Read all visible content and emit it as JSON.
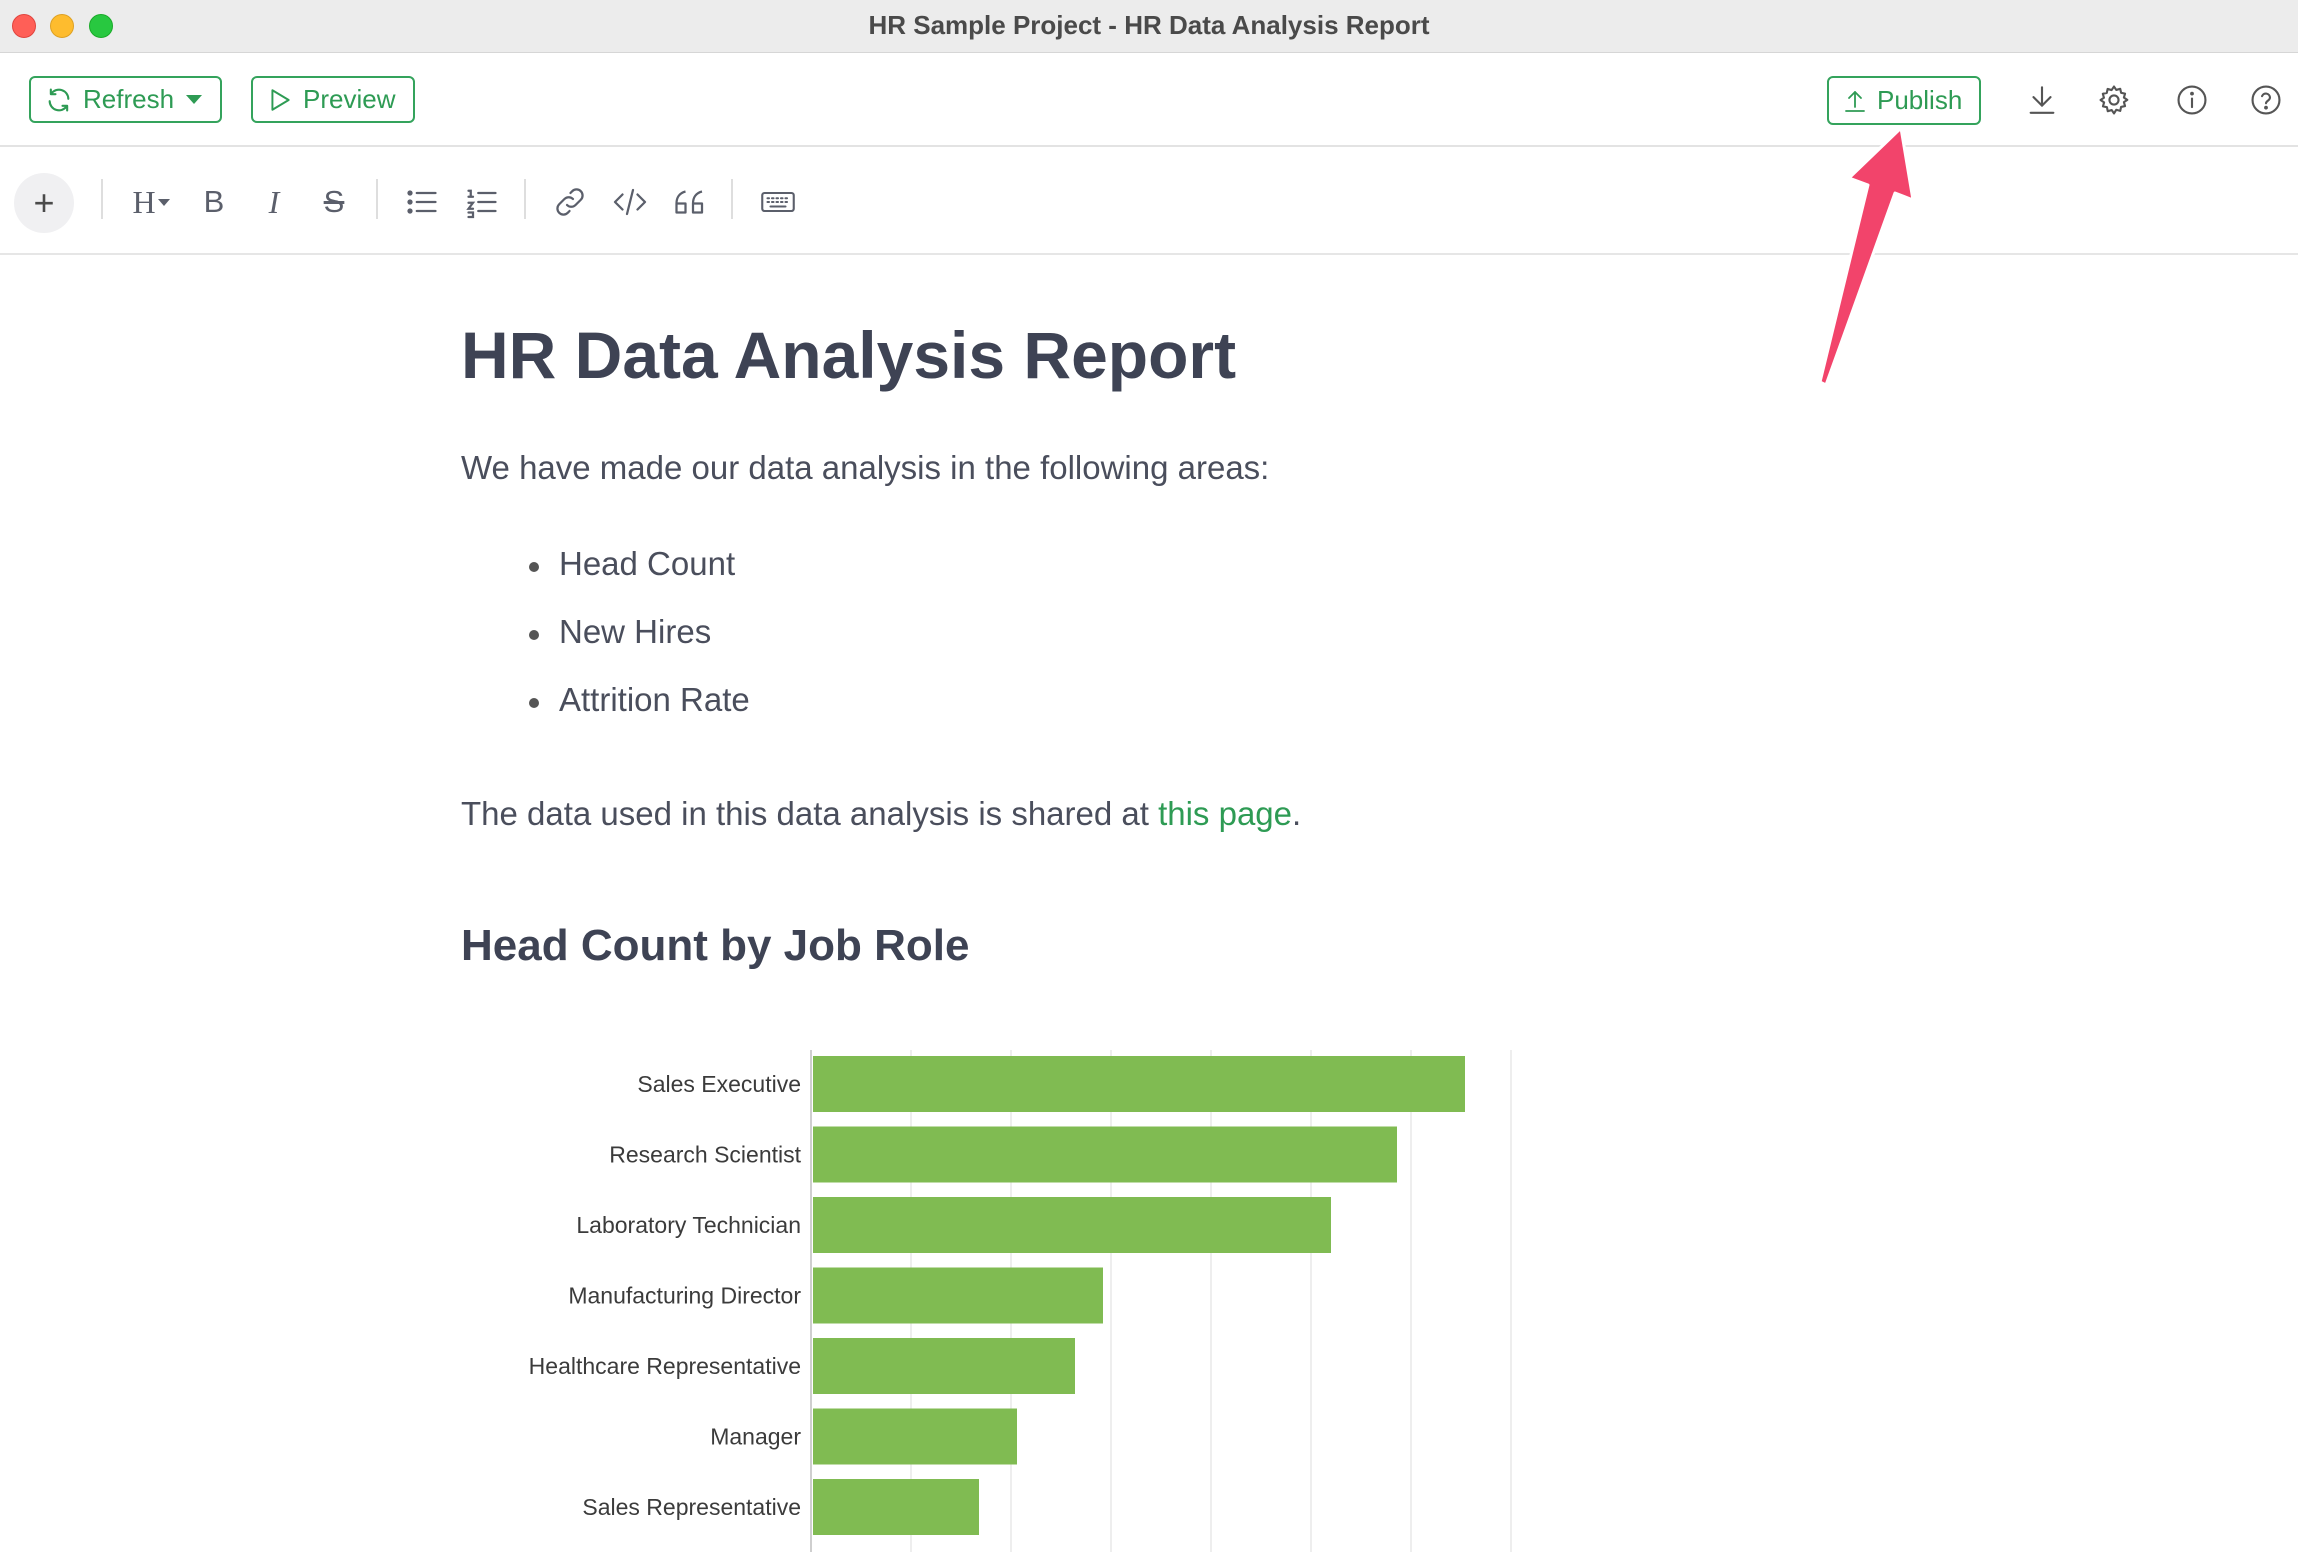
{
  "window": {
    "title": "HR Sample Project - HR Data Analysis Report"
  },
  "toolbar": {
    "refresh_label": "Refresh",
    "preview_label": "Preview",
    "publish_label": "Publish",
    "icons": [
      "download-icon",
      "gear-icon",
      "info-icon",
      "help-icon"
    ]
  },
  "format_toolbar": {
    "add": "+",
    "heading": "H",
    "bold": "B",
    "italic": "I",
    "strike": "S",
    "icons": [
      "bulleted-list-icon",
      "numbered-list-icon",
      "link-icon",
      "code-icon",
      "quote-icon",
      "keyboard-icon"
    ]
  },
  "document": {
    "title": "HR Data Analysis Report",
    "intro": "We have made our data analysis in the following areas:",
    "bullets": [
      "Head Count",
      "New Hires",
      "Attrition Rate"
    ],
    "shared_prefix": "The data used in this data analysis is shared at ",
    "shared_link": "this page",
    "shared_suffix": ".",
    "section_title": "Head Count by Job Role"
  },
  "colors": {
    "accent": "#2e9b54",
    "bar": "#80bb52",
    "arrow": "#f2446b"
  },
  "chart_data": {
    "type": "bar",
    "orientation": "horizontal",
    "categories": [
      "Sales Executive",
      "Research Scientist",
      "Laboratory Technician",
      "Manufacturing Director",
      "Healthcare Representative",
      "Manager",
      "Sales Representative"
    ],
    "values": [
      326,
      292,
      259,
      145,
      131,
      102,
      83
    ],
    "xlim": [
      0,
      350
    ],
    "grid_step": 50,
    "grid": true,
    "title": "",
    "xlabel": "",
    "ylabel": ""
  }
}
